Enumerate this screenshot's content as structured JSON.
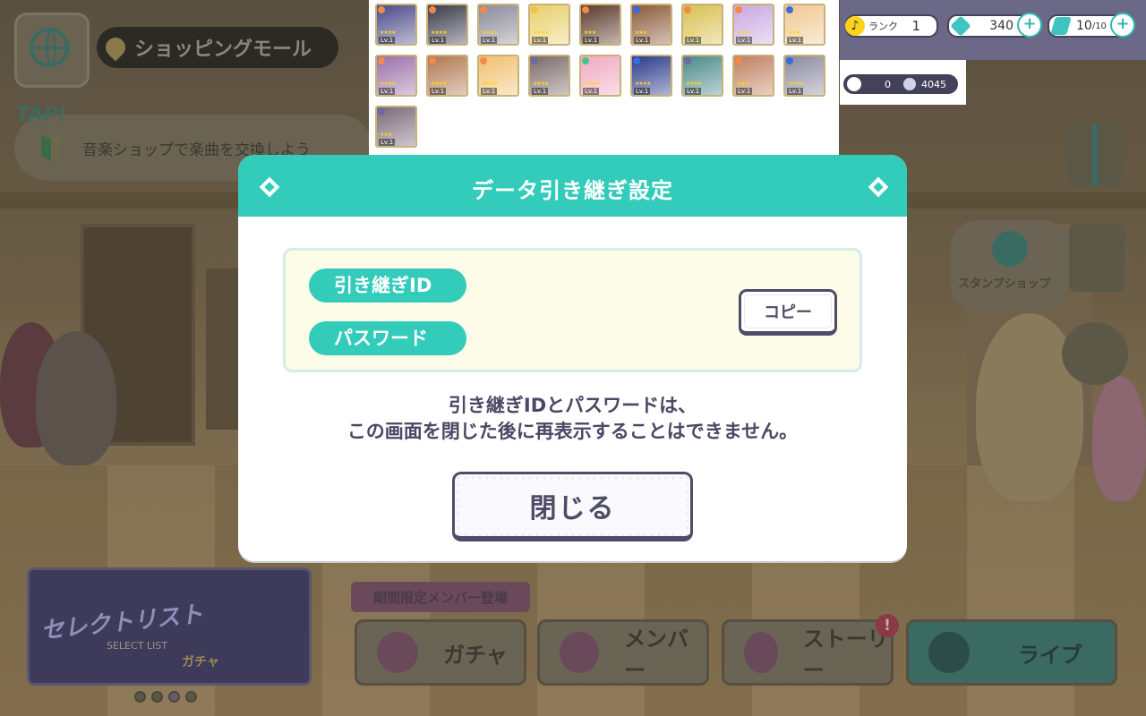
{
  "location": {
    "name": "ショッピングモール"
  },
  "hint": {
    "tap_label": "TAP!",
    "text": "音楽ショップで楽曲を交換しよう"
  },
  "header": {
    "rank_label": "ランク",
    "rank_value": "1",
    "crystals": "340",
    "stamina": "10",
    "stamina_max": "/10",
    "sub_currency_1": "0",
    "sub_currency_2": "4045"
  },
  "cards": [
    {
      "attr": "#f08a4a",
      "color": "#4a4a8a",
      "level": "Lv.1",
      "stars": "★★★★"
    },
    {
      "attr": "#f08a4a",
      "color": "#3a3a4a",
      "level": "Lv.1",
      "stars": "★★★★"
    },
    {
      "attr": "#f08a4a",
      "color": "#8a8a9a",
      "level": "Lv.1",
      "stars": "★★★★"
    },
    {
      "attr": "#f0c44a",
      "color": "#e8d06a",
      "level": "Lv.1",
      "stars": "★★★★"
    },
    {
      "attr": "#f08a4a",
      "color": "#5a3a2a",
      "level": "Lv.1",
      "stars": "★★★"
    },
    {
      "attr": "#3a6ae0",
      "color": "#8a5a3a",
      "level": "Lv.1",
      "stars": "★★★"
    },
    {
      "attr": "#f08a4a",
      "color": "#d8c050",
      "level": "Lv.1",
      "stars": "★★★"
    },
    {
      "attr": "#f08a4a",
      "color": "#c8a8e0",
      "level": "Lv.1",
      "stars": "★★★"
    },
    {
      "attr": "#3a6ae0",
      "color": "#f0c890",
      "level": "Lv.1",
      "stars": "★★★"
    },
    {
      "attr": "#f08a4a",
      "color": "#9a70a8",
      "level": "Lv.1",
      "stars": "★★★★"
    },
    {
      "attr": "#f08a4a",
      "color": "#b07850",
      "level": "Lv.1",
      "stars": "★★★★"
    },
    {
      "attr": "#f08a4a",
      "color": "#f0c070",
      "level": "Lv.1",
      "stars": "★★★★"
    },
    {
      "attr": "#6a6aa0",
      "color": "#7a6a6a",
      "level": "Lv.1",
      "stars": "★★★★"
    },
    {
      "attr": "#3ac88a",
      "color": "#f0a8c0",
      "level": "Lv.1",
      "stars": "★★★★"
    },
    {
      "attr": "#3a6ae0",
      "color": "#2a3a8a",
      "level": "Lv.1",
      "stars": "★★★★"
    },
    {
      "attr": "#6a6aa0",
      "color": "#4a8a8a",
      "level": "Lv.1",
      "stars": "★★★★"
    },
    {
      "attr": "#f08a4a",
      "color": "#c08060",
      "level": "Lv.1",
      "stars": "★★★"
    },
    {
      "attr": "#3a6ae0",
      "color": "#8a8aa0",
      "level": "Lv.1",
      "stars": "★★★★"
    },
    {
      "attr": "#6a6aa0",
      "color": "#7a6a7a",
      "level": "Lv.1",
      "stars": "★★★"
    }
  ],
  "side": {
    "stamp_shop_label": "スタンプショップ"
  },
  "modal": {
    "title": "データ引き継ぎ設定",
    "id_label": "引き継ぎID",
    "password_label": "パスワード",
    "copy_label": "コピー",
    "notice_line1": "引き継ぎIDとパスワードは、",
    "notice_line2": "この画面を閉じた後に再表示することはできません。",
    "close_label": "閉じる"
  },
  "banner": {
    "logo": "セレクトリスト",
    "sub": "SELECT LIST",
    "gacha": "ガチャ"
  },
  "bottom": {
    "limited_tag": "期間限定メンバー登場",
    "gacha": "ガチャ",
    "member": "メンバー",
    "story": "ストーリー",
    "live": "ライブ",
    "badge": "!"
  }
}
